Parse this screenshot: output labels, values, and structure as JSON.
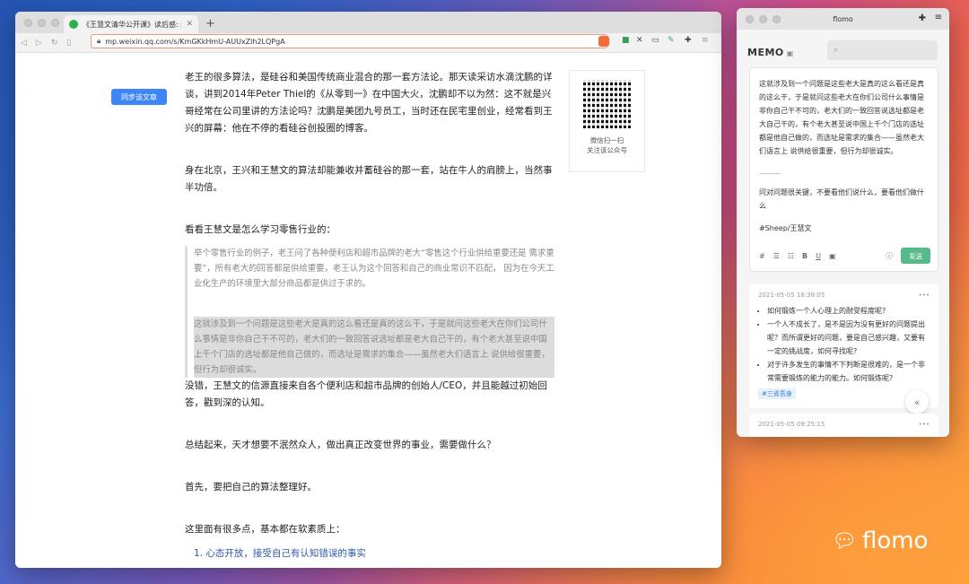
{
  "browser": {
    "tab_title": "《王慧文清华公开课》读后感: 给...",
    "url": "mp.weixin.qq.com/s/KmGKkHmU-AUUxZlh2LQPgA",
    "sync_button": "同步该文章",
    "qr_caption": "微信扫一扫\n关注该公众号"
  },
  "article": {
    "p1": "老王的很多算法，是硅谷和美国传统商业混合的那一套方法论。那天读采访水滴沈鹏的详谈，讲到2014年Peter Thiel的《从零到一》在中国大火，沈鹏却不以为然：这不就是兴哥经常在公司里讲的方法论吗？沈鹏是美团九号员工，当时还在民宅里创业，经常看到王兴的屏幕：他在不停的看硅谷创投圈的博客。",
    "p2": "身在北京，王兴和王慧文的算法却能兼收并蓄硅谷的那一套，站在牛人的肩膀上，当然事半功倍。",
    "p3": "看看王慧文是怎么学习零售行业的：",
    "quote1": "举个零售行业的例子，老王问了各种便利店和超市品牌的老大“零售这个行业供给重要还是 需求重要”，所有老大的回答都是供给重要，老王认为这个回答和自己的商业常识不匹配， 因为在今天工业化生产的环境里大部分商品都是供过于求的。",
    "quote2": "这就涉及到一个问题是这些老大是真的这么看还是真的这么干，于是就问这些老大在你们公司什么事情是非你自己干不可的，老大们的一致回答说选址都是老大自己干的，有个老大甚至说中国上千个门店的选址都是他自己做的，而选址是需求的集合——虽然老大们语言上 说供给很重要，但行为却很诚实。",
    "p4": "没错，王慧文的信源直接来自各个便利店和超市品牌的创始人/CEO，并且能越过初始回答，戳到深的认知。",
    "p5": "总结起来，天才想要不泯然众人，做出真正改变世界的事业，需要做什么？",
    "p6": "首先，要把自己的算法整理好。",
    "p7": "这里面有很多点，基本都在软素质上：",
    "list1": "1. 心态开放，接受自己有认知错误的事实"
  },
  "flomo": {
    "window_title": "flomo",
    "memo_label": "MEMO",
    "editor_text": "这就涉及到一个问题是这些老大是真的这么看还是真的这么干，于是就问这些老大在你们公司什么事情是非你自己干不可的，老大们的一致回答说选址都是老大自己干的，有个老大甚至说中国上千个门店的选址都是他自己做的，而选址是需求的集合——虽然老大们语言上 说供给很重要，但行为却很诚实。",
    "editor_dash": "———",
    "editor_note": "问对问题很关键，不要看他们说什么，要看他们做什么",
    "editor_tag": "#Sheep/王慧文",
    "send_label": "发送",
    "card1_time": "2021-05-05 18:38:05",
    "card1_items": [
      "如何锻炼一个人心理上的耐受程度呢?",
      "一个人不成长了，是不是因为没有更好的问题提出呢？而所谓更好的问题，要是自己感兴趣，又要有一定的挑战度，如何寻找呢?",
      "对于许多发生的事情不下判断是很难的，是一个非常需要锻炼的能力的能力。如何锻炼呢?"
    ],
    "card1_tag": "#三省吾身",
    "card2_time": "2021-05-05 09:25:15"
  },
  "watermark": "flomo"
}
